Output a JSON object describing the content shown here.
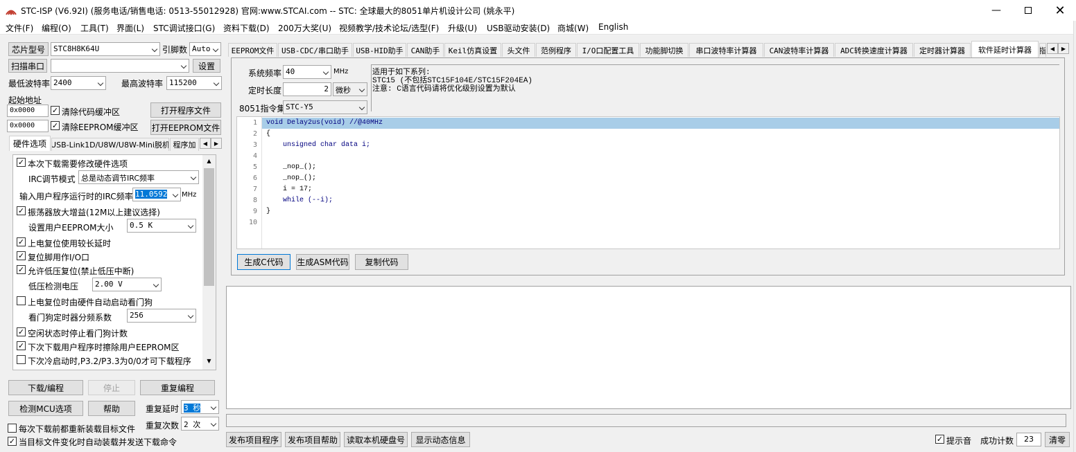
{
  "window": {
    "title": "STC-ISP (V6.92I) (服务电话/销售电话: 0513-55012928) 官网:www.STCAI.com  -- STC: 全球最大的8051单片机设计公司 (姚永平)"
  },
  "menu": [
    "文件(F)",
    "编程(O)",
    "工具(T)",
    "界面(L)",
    "STC调试接口(G)",
    "资料下载(D)",
    "200万大奖(U)",
    "视频教学/技术论坛/选型(F)",
    "升级(U)",
    "USB驱动安装(D)",
    "商城(W)",
    "English"
  ],
  "left": {
    "chip_btn": "芯片型号",
    "chip_value": "STC8H8K64U",
    "pin_label": "引脚数",
    "pin_value": "Auto",
    "scan_btn": "扫描串口",
    "port_value": "",
    "settings_btn": "设置",
    "min_baud_label": "最低波特率",
    "min_baud": "2400",
    "max_baud_label": "最高波特率",
    "max_baud": "115200",
    "start_addr_label": "起始地址",
    "addr1": "0x0000",
    "clear_code": "清除代码缓冲区",
    "open_prog": "打开程序文件",
    "addr2": "0x0000",
    "clear_eeprom": "清除EEPROM缓冲区",
    "open_eeprom": "打开EEPROM文件",
    "tabs": [
      "硬件选项",
      "USB-Link1D/U8W/U8W-Mini脱机",
      "程序加"
    ],
    "hw": {
      "opt1": "本次下载需要修改硬件选项",
      "irc_mode_label": "IRC调节模式",
      "irc_mode": "总是动态调节IRC频率",
      "irc_freq_label": "输入用户程序运行时的IRC频率",
      "irc_freq": "11.0592",
      "mhz": "MHz",
      "opt2": "振荡器放大增益(12M以上建议选择)",
      "eeprom_label": "设置用户EEPROM大小",
      "eeprom_size": "0.5 K",
      "opt3": "上电复位使用较长延时",
      "opt4": "复位脚用作I/O口",
      "opt5": "允许低压复位(禁止低压中断)",
      "lv_label": "低压检测电压",
      "lv_value": "2.00 V",
      "opt6": "上电复位时由硬件自动启动看门狗",
      "wdt_label": "看门狗定时器分频系数",
      "wdt_value": "256",
      "opt7": "空闲状态时停止看门狗计数",
      "opt8": "下次下载用户程序时擦除用户EEPROM区",
      "opt9": "下次冷启动时,P3.2/P3.3为0/0才可下载程序"
    },
    "download_btn": "下载/编程",
    "stop_btn": "停止",
    "reprog_btn": "重复编程",
    "detect_btn": "检测MCU选项",
    "help_btn": "帮助",
    "repeat_delay_label": "重复延时",
    "repeat_delay": "3 秒",
    "repeat_count_label": "重复次数",
    "repeat_count": "2 次",
    "reload_opt": "每次下载前都重新装载目标文件",
    "auto_opt": "当目标文件变化时自动装载并发送下载命令"
  },
  "right": {
    "tabs": [
      "EEPROM文件",
      "USB-CDC/串口助手",
      "USB-HID助手",
      "CAN助手",
      "Keil仿真设置",
      "头文件",
      "范例程序",
      "I/O口配置工具",
      "功能脚切换",
      "串口波特率计算器",
      "CAN波特率计算器",
      "ADC转换速度计算器",
      "定时器计算器",
      "软件延时计算器",
      "指"
    ],
    "freq_label": "系统频率",
    "freq_value": "40",
    "freq_unit": "MHz",
    "len_label": "定时长度",
    "len_value": "2",
    "len_unit": "微秒",
    "isa_label": "8051指令集",
    "isa_value": "STC-Y5",
    "info": [
      "适用于如下系列:",
      "STC15 (不包括STC15F104E/STC15F204EA)",
      "注意: C语言代码请将优化级别设置为默认"
    ],
    "code_lines": [
      {
        "n": "1",
        "text": "void Delay2us(void) //@40MHz"
      },
      {
        "n": "2",
        "text": "{"
      },
      {
        "n": "3",
        "text": "    unsigned char data i;"
      },
      {
        "n": "4",
        "text": ""
      },
      {
        "n": "5",
        "text": "    _nop_();"
      },
      {
        "n": "6",
        "text": "    _nop_();"
      },
      {
        "n": "7",
        "text": "    i = 17;"
      },
      {
        "n": "8",
        "text": "    while (--i);"
      },
      {
        "n": "9",
        "text": "}"
      },
      {
        "n": "10",
        "text": ""
      }
    ],
    "gen_c": "生成C代码",
    "gen_asm": "生成ASM代码",
    "copy": "复制代码",
    "bottom_btns": [
      "发布项目程序",
      "发布项目帮助",
      "读取本机硬盘号",
      "显示动态信息"
    ],
    "beep": "提示音",
    "count_label": "成功计数",
    "count": "23",
    "clear": "清零"
  }
}
